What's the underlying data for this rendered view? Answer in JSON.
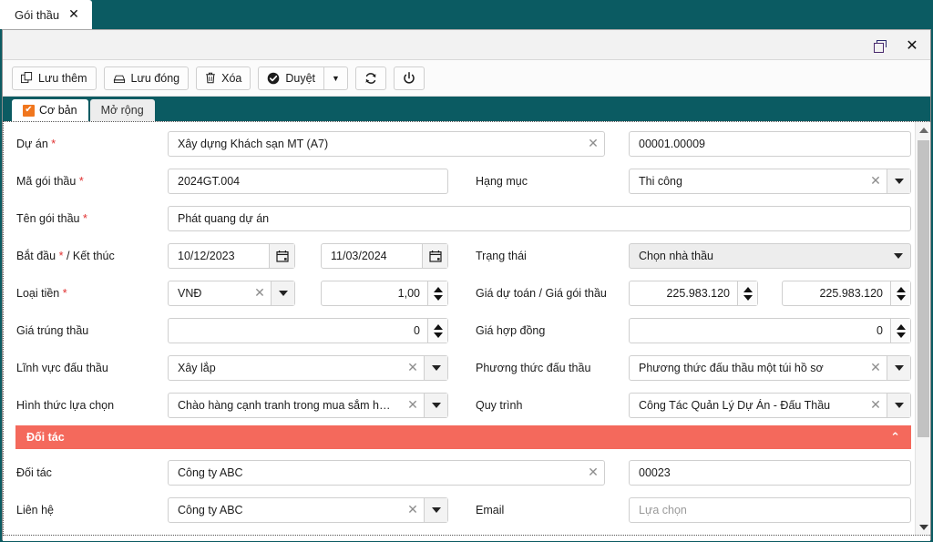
{
  "app_tab": {
    "label": "Gói thầu",
    "close_icon": "✕"
  },
  "window": {
    "restore_icon": "restore-icon",
    "close_icon": "✕"
  },
  "toolbar": {
    "buttons": [
      {
        "label": "Lưu thêm",
        "icon": "copy-icon"
      },
      {
        "label": "Lưu đóng",
        "icon": "save-close-icon"
      },
      {
        "label": "Xóa",
        "icon": "trash-icon"
      },
      {
        "label": "Duyệt",
        "icon": "check-circle-icon"
      }
    ],
    "approve_dropdown_caret": "▼",
    "refresh_icon": "refresh-icon",
    "power_icon": "power-icon"
  },
  "tabs": [
    {
      "label": "Cơ bản",
      "active": true,
      "check": "✔"
    },
    {
      "label": "Mở rộng",
      "active": false
    }
  ],
  "form": {
    "du_an": {
      "label": "Dự án",
      "required": "*",
      "value": "Xây dựng Khách sạn MT (A7)",
      "code_value": "00001.00009"
    },
    "ma_goi_thau": {
      "label": "Mã gói thầu",
      "required": "*",
      "value": "2024GT.004"
    },
    "hang_muc": {
      "label": "Hạng mục",
      "value": "Thi công"
    },
    "ten_goi_thau": {
      "label": "Tên gói thầu",
      "required": "*",
      "value": "Phát quang dự án"
    },
    "bat_dau_ket_thuc": {
      "label": "Bắt đầu",
      "required": "*",
      "label_suffix": "/ Kết thúc",
      "start": "10/12/2023",
      "end": "11/03/2024"
    },
    "trang_thai": {
      "label": "Trạng thái",
      "value": "Chọn nhà thầu"
    },
    "loai_tien": {
      "label": "Loại tiền",
      "required": "*",
      "value": "VNĐ",
      "rate": "1,00"
    },
    "gia_du_toan": {
      "label": "Giá dự toán / Giá gói thầu",
      "value1": "225.983.120",
      "value2": "225.983.120"
    },
    "gia_trung_thau": {
      "label": "Giá trúng thầu",
      "value": "0"
    },
    "gia_hop_dong": {
      "label": "Giá hợp đồng",
      "value": "0"
    },
    "linh_vuc_dau_thau": {
      "label": "Lĩnh vực đấu thầu",
      "value": "Xây lắp"
    },
    "phuong_thuc_dau_thau": {
      "label": "Phương thức đấu thầu",
      "value": "Phương thức đấu thầu một túi hồ sơ"
    },
    "hinh_thuc_lua_chon": {
      "label": "Hình thức lựa chọn",
      "value": "Chào hàng cạnh tranh trong mua sắm hàng hóa"
    },
    "quy_trinh": {
      "label": "Quy trình",
      "value": "Công Tác Quản Lý Dự Án - Đấu Thầu"
    }
  },
  "partner_section": {
    "title": "Đối tác",
    "collapse_icon": "⌃",
    "doi_tac": {
      "label": "Đối tác",
      "value": "Công ty ABC",
      "code_value": "00023"
    },
    "lien_he": {
      "label": "Liên hệ",
      "value": "Công ty ABC"
    },
    "email": {
      "label": "Email",
      "placeholder": "Lựa chọn"
    }
  },
  "icons": {
    "clear": "✕",
    "caret_down": "▼"
  },
  "colors": {
    "teal": "#0b5b62",
    "section_red": "#f4695c",
    "check_orange": "#f0761e",
    "required_red": "#e03030"
  }
}
